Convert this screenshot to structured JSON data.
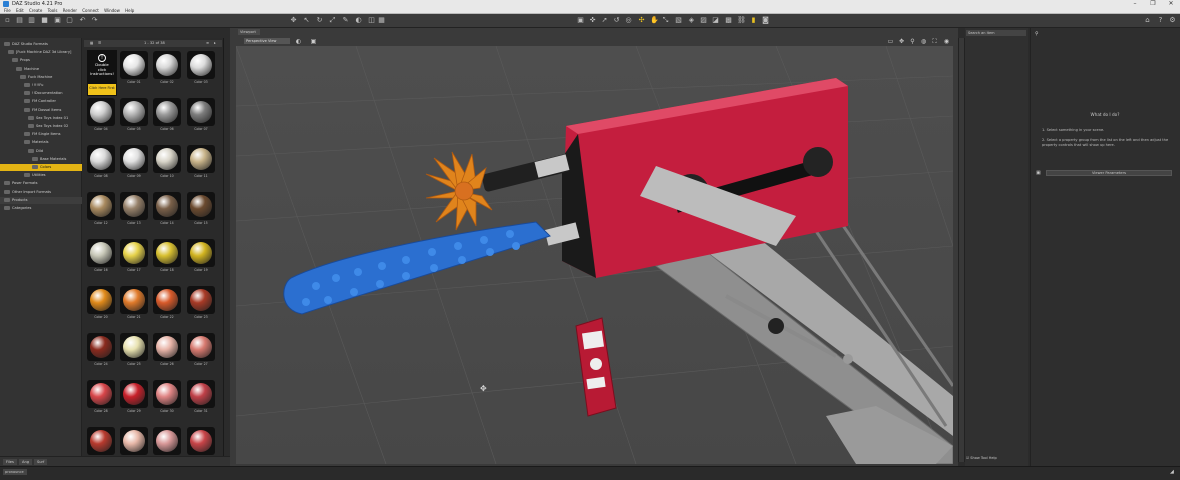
{
  "window": {
    "title": "DAZ Studio 4.21 Pro",
    "minimize": "–",
    "maximize": "❐",
    "close": "✕"
  },
  "menu": [
    "File",
    "Edit",
    "Create",
    "Tools",
    "Render",
    "Connect",
    "Window",
    "Help"
  ],
  "scene_tree": [
    {
      "label": "DAZ Studio Formats",
      "indent": 1
    },
    {
      "label": "[Fuck Machine DAZ 3d Library]",
      "indent": 2
    },
    {
      "label": "Props",
      "indent": 3
    },
    {
      "label": "Machine",
      "indent": 4
    },
    {
      "label": "Fuck Machine",
      "indent": 5
    },
    {
      "label": "!!!!!Fu",
      "indent": 6
    },
    {
      "label": "!!Documentation",
      "indent": 6
    },
    {
      "label": "FM Controller",
      "indent": 6
    },
    {
      "label": "FM Dossal Items",
      "indent": 6
    },
    {
      "label": "Sex Toys Index 01",
      "indent": 7
    },
    {
      "label": "Sex Toys Index 02",
      "indent": 7
    },
    {
      "label": "FM Single Items",
      "indent": 6
    },
    {
      "label": "Materials",
      "indent": 6
    },
    {
      "label": "Dild",
      "indent": 7
    },
    {
      "label": "Base Materials",
      "indent": 8
    },
    {
      "label": "Colors",
      "indent": 8,
      "selected": true
    },
    {
      "label": "Utilities",
      "indent": 6
    },
    {
      "label": "Poser Formats",
      "indent": 1
    },
    {
      "label": "Other Import Formats",
      "indent": 1
    },
    {
      "label": "Products",
      "indent": 1,
      "hl": true
    },
    {
      "label": "Categories",
      "indent": 1
    }
  ],
  "content": {
    "count": "1 - 32 of 38",
    "instruction": {
      "line1": "Double",
      "line2": "click",
      "line3": "Instructions!",
      "footer": "Click Here First"
    },
    "thumbs": [
      {
        "label": "Color 01",
        "c": "#e6e6e6"
      },
      {
        "label": "Color 02",
        "c": "#d8d8d8"
      },
      {
        "label": "Color 03",
        "c": "#dcdcdc"
      },
      {
        "label": "Color 04",
        "c": "#cfcfcf"
      },
      {
        "label": "Color 05",
        "c": "#b4b4b4"
      },
      {
        "label": "Color 06",
        "c": "#9a9a9a"
      },
      {
        "label": "Color 07",
        "c": "#7d7d7d"
      },
      {
        "label": "Color 08",
        "c": "#dadada"
      },
      {
        "label": "Color 09",
        "c": "#e0e0e0"
      },
      {
        "label": "Color 10",
        "c": "#d8d4c8"
      },
      {
        "label": "Color 11",
        "c": "#c9b48a"
      },
      {
        "label": "Color 12",
        "c": "#a98a5f"
      },
      {
        "label": "Color 13",
        "c": "#96816a"
      },
      {
        "label": "Color 14",
        "c": "#7a6049"
      },
      {
        "label": "Color 15",
        "c": "#6b4a2f"
      },
      {
        "label": "Color 16",
        "c": "#c8c8b8"
      },
      {
        "label": "Color 17",
        "c": "#e6d24a"
      },
      {
        "label": "Color 18",
        "c": "#d8c030"
      },
      {
        "label": "Color 19",
        "c": "#d2b420"
      },
      {
        "label": "Color 20",
        "c": "#e08a1a"
      },
      {
        "label": "Color 21",
        "c": "#e07a2a"
      },
      {
        "label": "Color 22",
        "c": "#d85a2a"
      },
      {
        "label": "Color 23",
        "c": "#a83a26"
      },
      {
        "label": "Color 24",
        "c": "#8a2a1e"
      },
      {
        "label": "Color 25",
        "c": "#e8e2b0"
      },
      {
        "label": "Color 26",
        "c": "#e8b4a8"
      },
      {
        "label": "Color 27",
        "c": "#d87a70"
      },
      {
        "label": "Color 28",
        "c": "#d8464a"
      },
      {
        "label": "Color 29",
        "c": "#c8202a"
      },
      {
        "label": "Color 30",
        "c": "#e08484"
      },
      {
        "label": "Color 31",
        "c": "#c04048"
      },
      {
        "label": "Color 32",
        "c": "#b83a2e"
      },
      {
        "label": "Color 33",
        "c": "#e8b8a8"
      },
      {
        "label": "Color 34",
        "c": "#d89898"
      },
      {
        "label": "Color 35",
        "c": "#c84448"
      }
    ]
  },
  "left_tabs": [
    "Files",
    "Ang",
    "Surf"
  ],
  "viewport": {
    "tab": "Viewport",
    "camera": "Perspective View"
  },
  "right": {
    "search_placeholder": "Search an item",
    "help_title": "What do I do?",
    "step1_num": "1",
    "step1": "Select something in your scene.",
    "step2_num": "2",
    "step2": "Select a property group from the list on the left and then adjust the property controls that will show up here.",
    "button": "Viewer Parameters",
    "tool_help": "Show Tool Help"
  },
  "status": {
    "field": "pronounce"
  }
}
